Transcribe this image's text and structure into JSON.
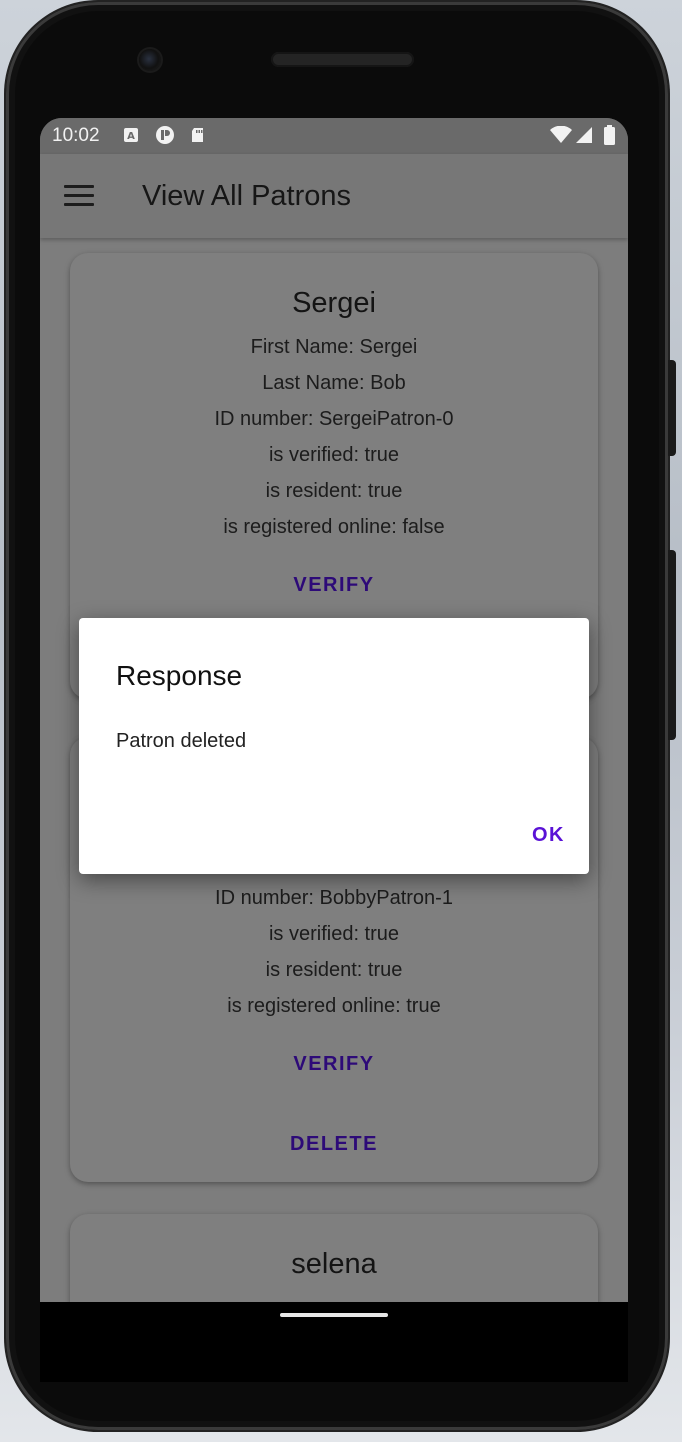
{
  "status_bar": {
    "time": "10:02"
  },
  "app_bar": {
    "title": "View All Patrons"
  },
  "cards": [
    {
      "name": "Sergei",
      "lines": [
        "First Name: Sergei",
        "Last Name: Bob",
        "ID number: SergeiPatron-0",
        "is verified: true",
        "is resident: true",
        "is registered online: false"
      ],
      "verify_label": "VERIFY"
    },
    {
      "lines": [
        "ID number: BobbyPatron-1",
        "is verified: true",
        "is resident: true",
        "is registered online: true"
      ],
      "verify_label": "VERIFY",
      "delete_label": "DELETE"
    },
    {
      "name": "selena"
    }
  ],
  "dialog": {
    "title": "Response",
    "message": "Patron deleted",
    "ok_label": "OK"
  },
  "colors": {
    "accent": "#5a12d6",
    "card_button": "#2d0a78",
    "scrim": "#7d7d7d"
  }
}
